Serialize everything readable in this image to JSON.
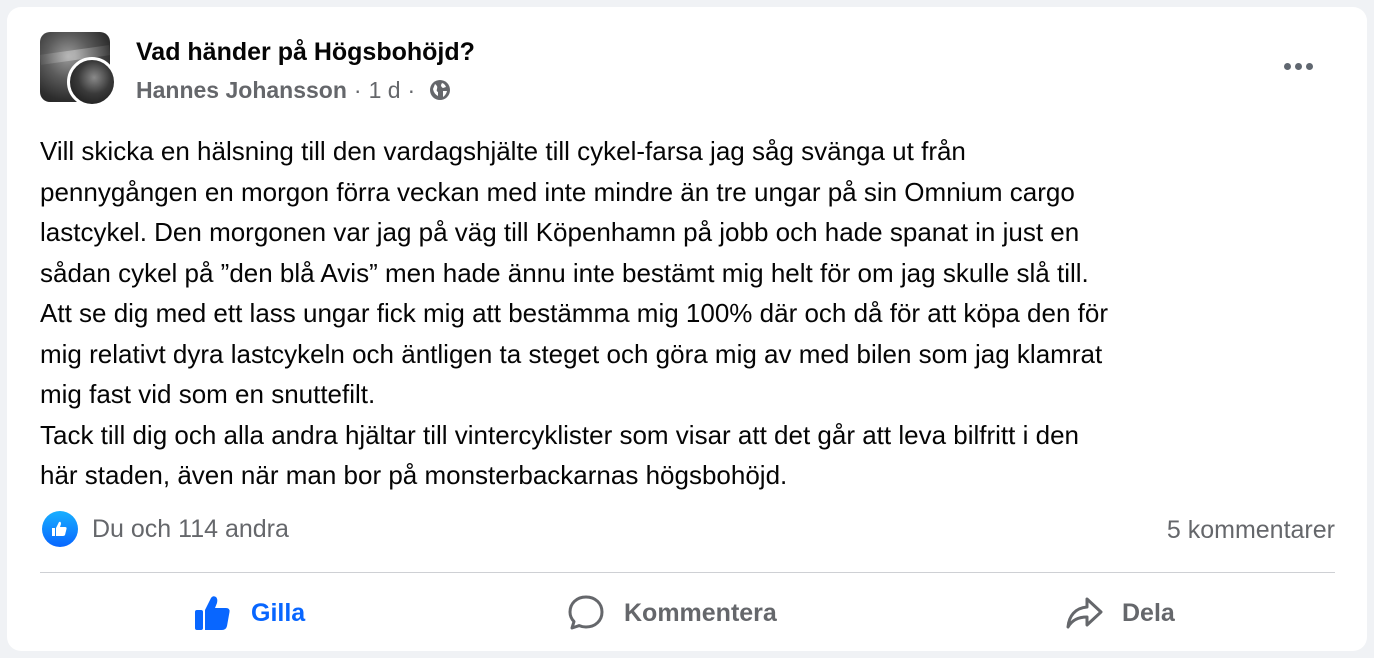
{
  "post": {
    "group_name": "Vad händer på Högsbohöjd?",
    "author": "Hannes Johansson",
    "separator": "·",
    "time": "1 d",
    "body_lines": [
      "Vill skicka en hälsning till den vardagshjälte till cykel-farsa jag såg svänga ut från",
      "pennygången en morgon förra veckan med inte mindre än tre ungar på sin Omnium cargo",
      "lastcykel. Den morgonen var jag på väg till Köpenhamn på jobb och hade spanat in just en",
      "sådan cykel på ”den blå Avis” men hade ännu inte bestämt mig helt för om jag skulle slå till.",
      "Att se dig med ett lass ungar fick mig att bestämma mig 100% där och då för att köpa den för",
      "mig relativt dyra lastcykeln och äntligen ta steget och göra mig av med bilen som jag klamrat",
      "mig fast vid som en snuttefilt.",
      "Tack till dig och alla andra hjältar till vintercyklister som visar att det går att leva bilfritt i den",
      "här staden, även när man bor på monsterbackarnas högsbohöjd."
    ],
    "reactions_text": "Du och 114 andra",
    "comments_text": "5 kommentarer"
  },
  "actions": {
    "like_label": "Gilla",
    "comment_label": "Kommentera",
    "share_label": "Dela"
  },
  "colors": {
    "accent": "#0866ff",
    "secondary_text": "#65676b",
    "primary_text": "#050505"
  },
  "icons": {
    "privacy": "globe-icon",
    "more": "more-options-icon",
    "like": "thumbs-up-icon",
    "comment": "comment-bubble-icon",
    "share": "share-arrow-icon"
  }
}
